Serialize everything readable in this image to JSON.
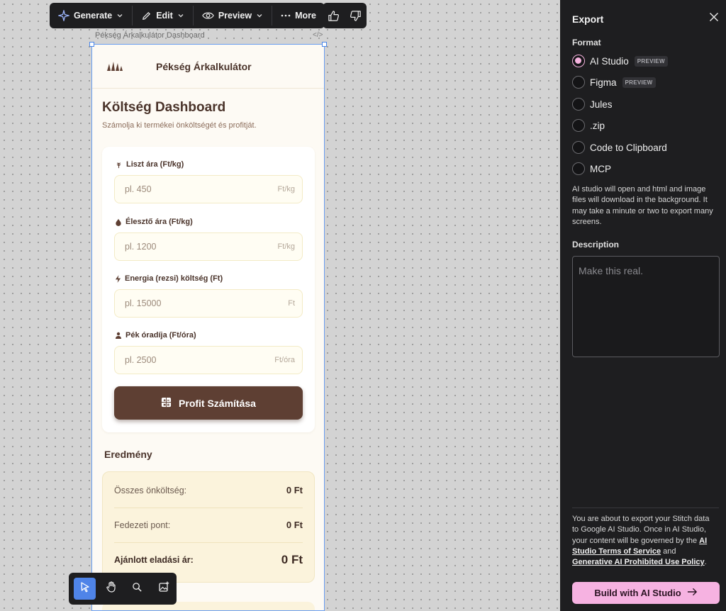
{
  "toolbar": {
    "generate_label": "Generate",
    "edit_label": "Edit",
    "preview_label": "Preview",
    "more_label": "More"
  },
  "frame": {
    "label": "Pékség Árkalkulátor Dashboard",
    "code_glyph": "</>"
  },
  "app": {
    "title": "Pékség Árkalkulátor",
    "dashboard_title": "Költség Dashboard",
    "dashboard_subtitle": "Számolja ki termékei önköltségét és profitját.",
    "fields": [
      {
        "label": "Liszt ára (Ft/kg)",
        "placeholder": "pl. 450",
        "unit": "Ft/kg",
        "icon": "wheat-icon"
      },
      {
        "label": "Élesztő ára (Ft/kg)",
        "placeholder": "pl. 1200",
        "unit": "Ft/kg",
        "icon": "drop-icon"
      },
      {
        "label": "Energia (rezsi) költség (Ft)",
        "placeholder": "pl. 15000",
        "unit": "Ft",
        "icon": "bolt-icon"
      },
      {
        "label": "Pék óradíja (Ft/óra)",
        "placeholder": "pl. 2500",
        "unit": "Ft/óra",
        "icon": "person-icon"
      }
    ],
    "profit_button": "Profit Számítása",
    "result_title": "Eredmény",
    "results": [
      {
        "label": "Összes önköltség:",
        "value": "0 Ft"
      },
      {
        "label": "Fedezeti pont:",
        "value": "0 Ft"
      },
      {
        "label": "Ajánlott eladási ár:",
        "value": "0 Ft"
      }
    ]
  },
  "export_panel": {
    "title": "Export",
    "format_label": "Format",
    "options": [
      {
        "label": "AI Studio",
        "badge": "PREVIEW",
        "selected": true
      },
      {
        "label": "Figma",
        "badge": "PREVIEW",
        "selected": false
      },
      {
        "label": "Jules",
        "badge": "",
        "selected": false
      },
      {
        "label": ".zip",
        "badge": "",
        "selected": false
      },
      {
        "label": "Code to Clipboard",
        "badge": "",
        "selected": false
      },
      {
        "label": "MCP",
        "badge": "",
        "selected": false
      }
    ],
    "info_text": "AI studio will open and html and image files will download in the background. It may take a minute or two to export many screens.",
    "description_label": "Description",
    "description_placeholder": "Make this real.",
    "legal_prefix": "You are about to export your Stitch data to Google AI Studio. Once in AI Studio, your content will be governed by the ",
    "legal_link1": "AI Studio Terms of Service",
    "legal_mid": " and ",
    "legal_link2": "Generative AI Prohibited Use Policy",
    "legal_suffix": ".",
    "build_button": "Build with AI Studio"
  },
  "colors": {
    "accent_pink": "#f6b2e1",
    "brown_primary": "#5e3f33",
    "panel_bg": "#1e1e20",
    "selection_blue": "#4f84e8"
  }
}
